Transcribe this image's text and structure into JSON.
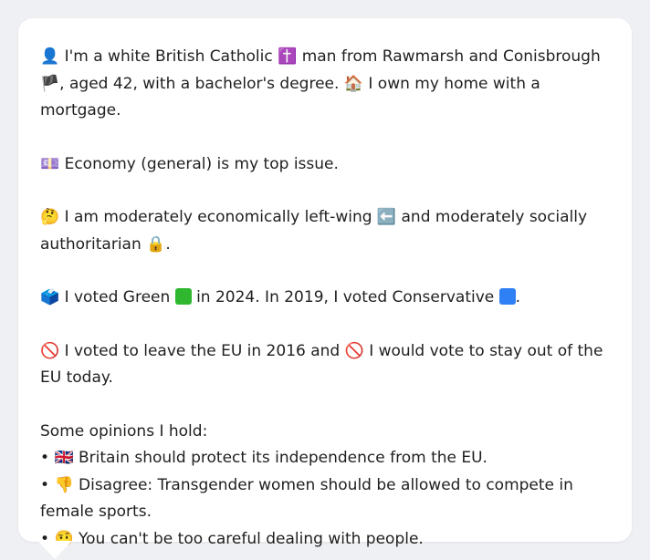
{
  "profile": {
    "identity": {
      "icon": "👤",
      "text1": "I'm a white British Catholic",
      "cross": "✝️",
      "text2": "man from Rawmarsh and Conisbrough",
      "flag": "🏴",
      "text3": ", aged 42, with a bachelor's degree.",
      "house": "🏠",
      "text4": "I own my home with a mortgage."
    },
    "issue": {
      "icon": "💷",
      "text": "Economy (general) is my top issue."
    },
    "ideology": {
      "icon": "🤔",
      "text1": "I am moderately economically left-wing",
      "arrow": "⬅️",
      "text2": "and moderately socially authoritarian",
      "lock": "🔒",
      "text3": "."
    },
    "votes": {
      "icon": "🗳️",
      "text1": "I voted Green",
      "green_color": "#2fb82f",
      "text2": "in 2024. In 2019, I voted Conservative",
      "blue_color": "#2f7ff5",
      "text3": "."
    },
    "brexit": {
      "icon1": "🚫",
      "text1": "I voted to leave the EU in 2016 and",
      "icon2": "🚫",
      "text2": "I would vote to stay out of the EU today."
    },
    "opinions": {
      "heading": "Some opinions I hold:",
      "items": [
        {
          "bullet": "•",
          "icon": "🇬🇧",
          "text": "Britain should protect its independence from the EU."
        },
        {
          "bullet": "•",
          "icon": "👎",
          "text": "Disagree: Transgender women should be allowed to compete in female sports."
        },
        {
          "bullet": "•",
          "icon": "🤨",
          "text": "You can't be too careful dealing with people."
        }
      ]
    }
  }
}
